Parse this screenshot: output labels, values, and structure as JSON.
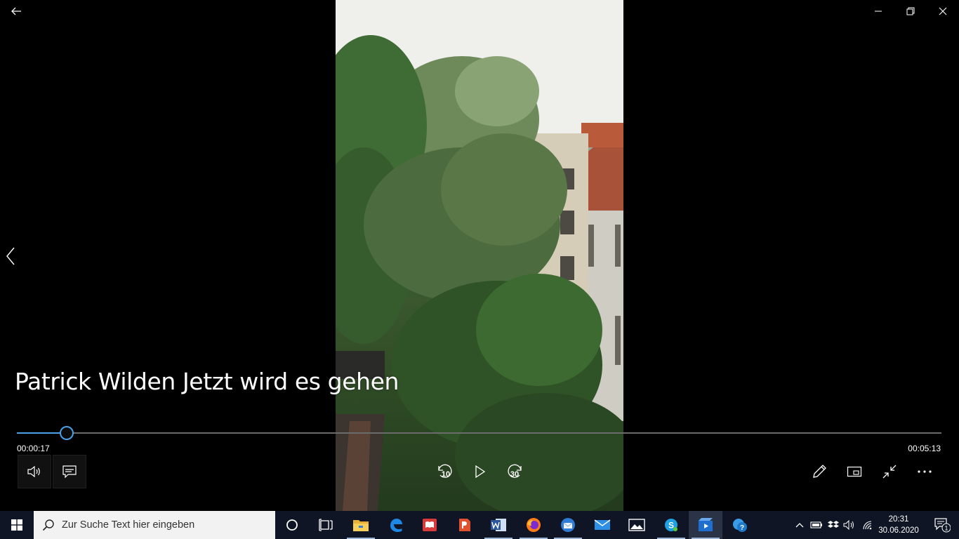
{
  "video": {
    "title": "Patrick Wilden Jetzt wird es gehen",
    "current_time": "00:00:17",
    "total_time": "00:05:13",
    "progress": 0.054
  },
  "window_controls": {
    "back_icon": "back-arrow-icon",
    "minimize_icon": "minimize-icon",
    "maximize_icon": "restore-icon",
    "close_icon": "close-icon"
  },
  "controls": {
    "volume_icon": "speaker-icon",
    "subtitles_icon": "captions-icon",
    "skip_back_label": "10",
    "skip_forward_label": "30",
    "play_icon": "play-icon",
    "edit_icon": "pencil-icon",
    "miniview_icon": "mini-view-icon",
    "fullscreen_exit_icon": "exit-fullscreen-icon",
    "more_icon": "more-icon"
  },
  "taskbar": {
    "search_placeholder": "Zur Suche Text hier eingeben",
    "apps": [
      {
        "icon": "cortana-icon"
      },
      {
        "icon": "task-view-icon"
      },
      {
        "icon": "file-explorer-icon"
      },
      {
        "icon": "edge-icon"
      },
      {
        "icon": "reader-icon"
      },
      {
        "icon": "powerpoint-icon"
      },
      {
        "icon": "word-icon"
      },
      {
        "icon": "firefox-icon"
      },
      {
        "icon": "thunderbird-icon"
      },
      {
        "icon": "mail-icon"
      },
      {
        "icon": "photos-icon"
      },
      {
        "icon": "skype-icon"
      },
      {
        "icon": "movies-tv-icon",
        "active": true
      },
      {
        "icon": "help-icon"
      }
    ],
    "time": "20:31",
    "date": "30.06.2020",
    "notification_count": "1"
  },
  "colors": {
    "accent": "#4aa0e6",
    "taskbar": "#0f1524"
  }
}
